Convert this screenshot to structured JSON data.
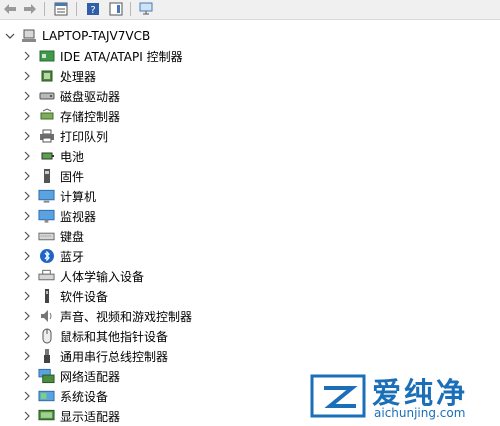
{
  "toolbar": {
    "buttons": [
      "back-icon",
      "forward-icon",
      "properties-icon",
      "help-icon",
      "action-pane-icon",
      "monitor-icon"
    ]
  },
  "tree": {
    "root": "LAPTOP-TAJV7VCB",
    "items": [
      {
        "label": "IDE ATA/ATAPI 控制器",
        "icon": "ide-controller-icon"
      },
      {
        "label": "处理器",
        "icon": "processor-icon"
      },
      {
        "label": "磁盘驱动器",
        "icon": "disk-drive-icon"
      },
      {
        "label": "存储控制器",
        "icon": "storage-controller-icon"
      },
      {
        "label": "打印队列",
        "icon": "printer-icon"
      },
      {
        "label": "电池",
        "icon": "battery-icon"
      },
      {
        "label": "固件",
        "icon": "firmware-icon"
      },
      {
        "label": "计算机",
        "icon": "computer-icon"
      },
      {
        "label": "监视器",
        "icon": "monitor-icon"
      },
      {
        "label": "键盘",
        "icon": "keyboard-icon"
      },
      {
        "label": "蓝牙",
        "icon": "bluetooth-icon"
      },
      {
        "label": "人体学输入设备",
        "icon": "hid-icon"
      },
      {
        "label": "软件设备",
        "icon": "software-device-icon"
      },
      {
        "label": "声音、视频和游戏控制器",
        "icon": "sound-icon"
      },
      {
        "label": "鼠标和其他指针设备",
        "icon": "mouse-icon"
      },
      {
        "label": "通用串行总线控制器",
        "icon": "usb-icon"
      },
      {
        "label": "网络适配器",
        "icon": "network-adapter-icon"
      },
      {
        "label": "系统设备",
        "icon": "system-device-icon"
      },
      {
        "label": "显示适配器",
        "icon": "display-adapter-icon"
      }
    ]
  },
  "watermark": {
    "brand": "爱纯净",
    "url": "aichunjing.com"
  }
}
